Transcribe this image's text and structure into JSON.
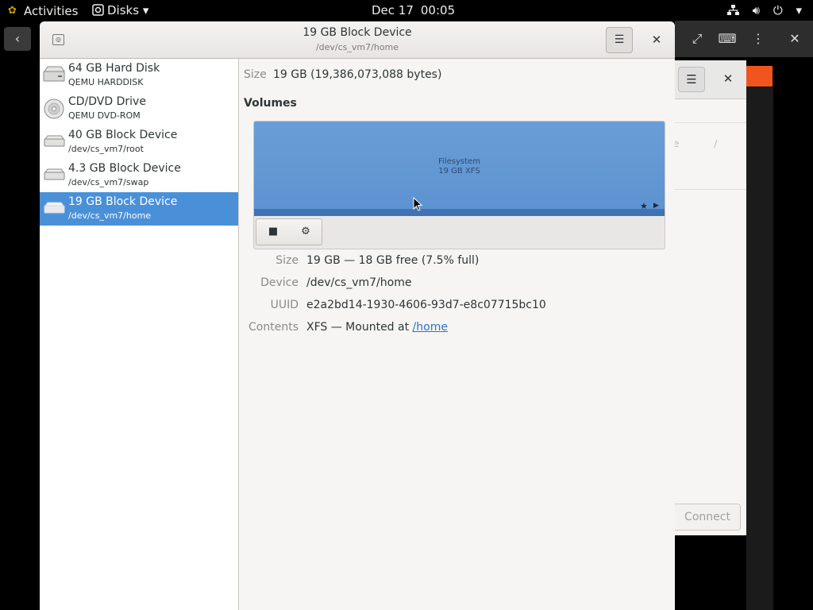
{
  "topbar": {
    "activities": "Activities",
    "app_menu": "Disks",
    "app_menu_arrow": "▾",
    "date": "Dec 17",
    "time": "00:05",
    "system_menu_arrow": "▾"
  },
  "background_window": {
    "hamburger": "☰",
    "close": "✕",
    "faint_text": "e  /",
    "connect_label": "Connect"
  },
  "window": {
    "title": "19 GB Block Device",
    "subtitle": "/dev/cs_vm7/home",
    "menu_glyph": "☰",
    "close_glyph": "✕"
  },
  "drives": [
    {
      "name": "64 GB Hard Disk",
      "sub": "QEMU HARDDISK",
      "icon": "hard-disk-icon",
      "selected": false
    },
    {
      "name": "CD/DVD Drive",
      "sub": "QEMU DVD-ROM",
      "icon": "optical-drive-icon",
      "selected": false
    },
    {
      "name": "40 GB Block Device",
      "sub": "/dev/cs_vm7/root",
      "icon": "block-device-icon",
      "selected": false
    },
    {
      "name": "4.3 GB Block Device",
      "sub": "/dev/cs_vm7/swap",
      "icon": "block-device-icon",
      "selected": false
    },
    {
      "name": "19 GB Block Device",
      "sub": "/dev/cs_vm7/home",
      "icon": "block-device-icon",
      "selected": true
    }
  ],
  "details": {
    "size_label": "Size",
    "size_value": "19 GB (19,386,073,088 bytes)",
    "volumes_label": "Volumes",
    "partition": {
      "name": "Filesystem",
      "sub": "19 GB XFS"
    },
    "stop_glyph": "■",
    "gear_glyph": "⚙",
    "properties": [
      {
        "label": "Size",
        "value": "19 GB — 18 GB free (7.5% full)"
      },
      {
        "label": "Device",
        "value": "/dev/cs_vm7/home"
      },
      {
        "label": "UUID",
        "value": "e2a2bd14-1930-4606-93d7-e8c07715bc10"
      },
      {
        "label": "Contents",
        "value": "XFS — Mounted at ",
        "link": "/home"
      }
    ]
  },
  "colors": {
    "selection": "#4a90d9",
    "partition": "#6a9dd6",
    "accent_orange": "#f1541c"
  }
}
